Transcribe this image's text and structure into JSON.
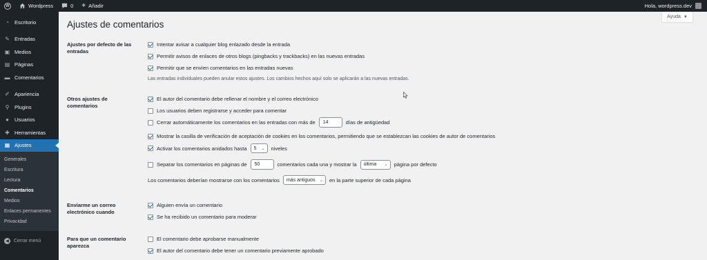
{
  "adminbar": {
    "site_name": "Wordpress",
    "comments_count": "0",
    "new_label": "Añadir",
    "greeting": "Hola, wordpress.dev"
  },
  "sidebar": {
    "items": [
      {
        "label": "Escritorio",
        "icon": "dashboard-icon"
      },
      {
        "label": "Entradas",
        "icon": "pin-icon"
      },
      {
        "label": "Medios",
        "icon": "media-icon"
      },
      {
        "label": "Páginas",
        "icon": "page-icon"
      },
      {
        "label": "Comentarios",
        "icon": "comment-icon"
      },
      {
        "label": "Apariencia",
        "icon": "brush-icon"
      },
      {
        "label": "Plugins",
        "icon": "plugin-icon"
      },
      {
        "label": "Usuarios",
        "icon": "users-icon"
      },
      {
        "label": "Herramientas",
        "icon": "wrench-icon"
      },
      {
        "label": "Ajustes",
        "icon": "settings-icon"
      }
    ],
    "submenu": [
      "Generales",
      "Escritura",
      "Lectura",
      "Comentarios",
      "Medios",
      "Enlaces permanentes",
      "Privacidad"
    ],
    "collapse_label": "Cerrar menú"
  },
  "help_label": "Ayuda",
  "page_title": "Ajustes de comentarios",
  "sections": {
    "defaults": {
      "label": "Ajustes por defecto de las entradas",
      "opt1": "Intentar avisar a cualquier blog enlazado desde la entrada",
      "opt2": "Permitir avisos de enlaces de otros blogs (pingbacks y trackbacks) en las nuevas entradas",
      "opt3": "Permitir que se envíen comentarios en las entradas nuevas",
      "note": "Las entradas individuales pueden anular estos ajustes. Los cambios hechos aquí solo se aplicarán a las nuevas entradas."
    },
    "other": {
      "label": "Otros ajustes de comentarios",
      "opt1": "El autor del comentario debe rellenar el nombre y el correo electrónico",
      "opt2": "Los usuarios deben registrarse y acceder para comentar",
      "opt3_pre": "Cerrar automáticamente los comentarios en las entradas con más de",
      "opt3_value": "14",
      "opt3_post": "días de antigüedad",
      "opt4": "Mostrar la casilla de verificación de aceptación de cookies en los comentarios, permitiendo que se establezcan las cookies de autor de comentarios",
      "opt5_pre": "Activar los comentarios anidados hasta",
      "opt5_value": "5",
      "opt5_post": "niveles",
      "opt6_pre": "Separar los comentarios en páginas de",
      "opt6_value": "50",
      "opt6_mid": "comentarios cada una y mostrar la",
      "opt6_select": "última",
      "opt6_post": "página por defecto",
      "opt7_pre": "Los comentarios deberían mostrarse con los comentarios",
      "opt7_select": "más antiguos",
      "opt7_post": "en la parte superior de cada página"
    },
    "email": {
      "label": "Enviarme un correo electrónico cuando",
      "opt1": "Alguien envía un comentario",
      "opt2": "Se ha recibido un comentario para moderar"
    },
    "appear": {
      "label": "Para que un comentario aparezca",
      "opt1": "El comentario debe aprobarse manualmente",
      "opt2": "El autor del comentario debe tener un comentario previamente aprobado"
    }
  },
  "colors": {
    "admin_dark": "#1d2327",
    "accent": "#2271b1",
    "background": "#f1f1f1"
  }
}
